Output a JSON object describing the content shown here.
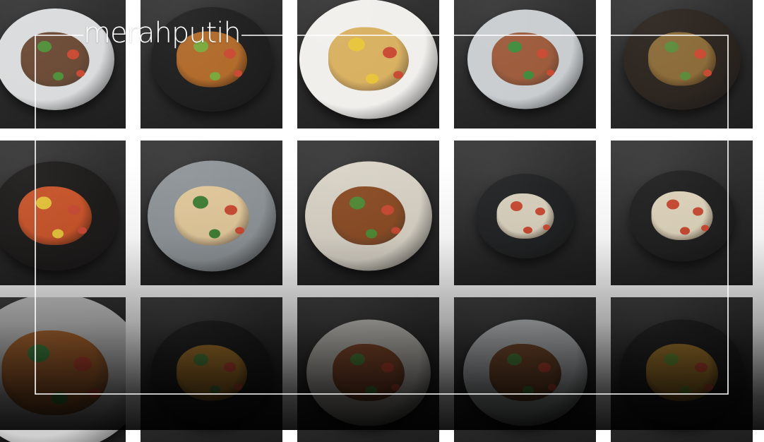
{
  "brand": {
    "logo_text": "merahputih"
  },
  "gallery": {
    "rows": [
      [
        {
          "dish": "braised-meat-bowl",
          "plate": "#d9dbdc",
          "food": "#6b4a35",
          "accent": "#4f8f3a",
          "size": 168
        },
        {
          "dish": "curry-bowl",
          "plate": "#1f1f1f",
          "food": "#b06a2a",
          "accent": "#7aa83c",
          "size": 172
        },
        {
          "dish": "dessert-plate",
          "plate": "#f1efec",
          "food": "#d8b060",
          "accent": "#e8c43a",
          "size": 196
        },
        {
          "dish": "fish-fillet-bowl",
          "plate": "#c9cdd0",
          "food": "#9c5a3a",
          "accent": "#3f8b3c",
          "size": 164
        },
        {
          "dish": "fried-fritter-bowl",
          "plate": "#2b241f",
          "food": "#8a6a38",
          "accent": "#5c8a3a",
          "size": 166
        }
      ],
      [
        {
          "dish": "sambal-plate",
          "plate": "#1e1b1b",
          "food": "#c8542a",
          "accent": "#e6c23a",
          "size": 180
        },
        {
          "dish": "tofu-skewer-plate",
          "plate": "#8e9498",
          "food": "#e2c89a",
          "accent": "#3f7d33",
          "size": 182
        },
        {
          "dish": "roasted-chicken-bowl",
          "plate": "#d8d2c6",
          "food": "#8a4b23",
          "accent": "#4e8a35",
          "size": 180
        },
        {
          "dish": "noodle-salad-plate",
          "plate": "#202122",
          "food": "#d9d1bd",
          "accent": "#c8482f",
          "size": 140
        },
        {
          "dish": "noodle-salad-bowl",
          "plate": "#1f1f20",
          "food": "#ded4bc",
          "accent": "#c8482f",
          "size": 150
        }
      ],
      [
        {
          "dish": "herb-curry-closeup",
          "plate": "#cfcfcf",
          "food": "#b56a2e",
          "accent": "#3f8f40",
          "size": 260
        },
        {
          "dish": "green-curry-bowl",
          "plate": "#1d1d1d",
          "food": "#b07a2a",
          "accent": "#4f8a3a",
          "size": 172
        },
        {
          "dish": "braised-beef-bowl",
          "plate": "#c9c7c0",
          "food": "#8a4a2a",
          "accent": "#4f8a3a",
          "size": 176
        },
        {
          "dish": "rib-stew-bowl",
          "plate": "#bfc3c5",
          "food": "#7a4a2a",
          "accent": "#4f8a3a",
          "size": 176
        },
        {
          "dish": "yellow-curry-bowl",
          "plate": "#1e1e1e",
          "food": "#b0802c",
          "accent": "#6e9a35",
          "size": 176
        }
      ]
    ]
  }
}
